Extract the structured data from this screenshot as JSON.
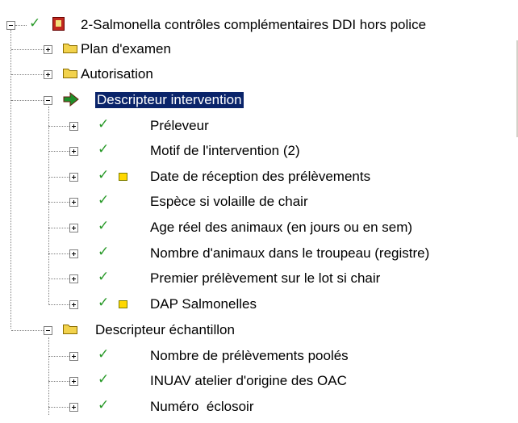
{
  "tree": {
    "root": {
      "label": "2-Salmonella contrôles complémentaires DDI hors police"
    },
    "plan": {
      "label": "Plan d'examen"
    },
    "autorisation": {
      "label": "Autorisation"
    },
    "descripteur_intervention": {
      "label": "Descripteur intervention",
      "items": [
        "Préleveur",
        "Motif de l'intervention (2)",
        "Date de réception des prélèvements",
        "Espèce si volaille de chair",
        "Age réel des animaux (en jours ou en sem)",
        "Nombre d'animaux dans le troupeau (registre)",
        "Premier prélèvement sur le lot si chair",
        "DAP Salmonelles"
      ]
    },
    "descripteur_echantillon": {
      "label": "Descripteur échantillon",
      "items": [
        "Nombre de prélèvements poolés",
        "INUAV atelier d'origine des OAC",
        "Numéro  éclosoir"
      ]
    }
  },
  "icons": {
    "check_color": "#2a9a2a",
    "folder_color": "#f2d24c",
    "selection_color": "#0a246a",
    "arrow_icon": "green-arrow-icon",
    "book_icon": "red-book-icon",
    "note_icon": "yellow-note-icon"
  }
}
